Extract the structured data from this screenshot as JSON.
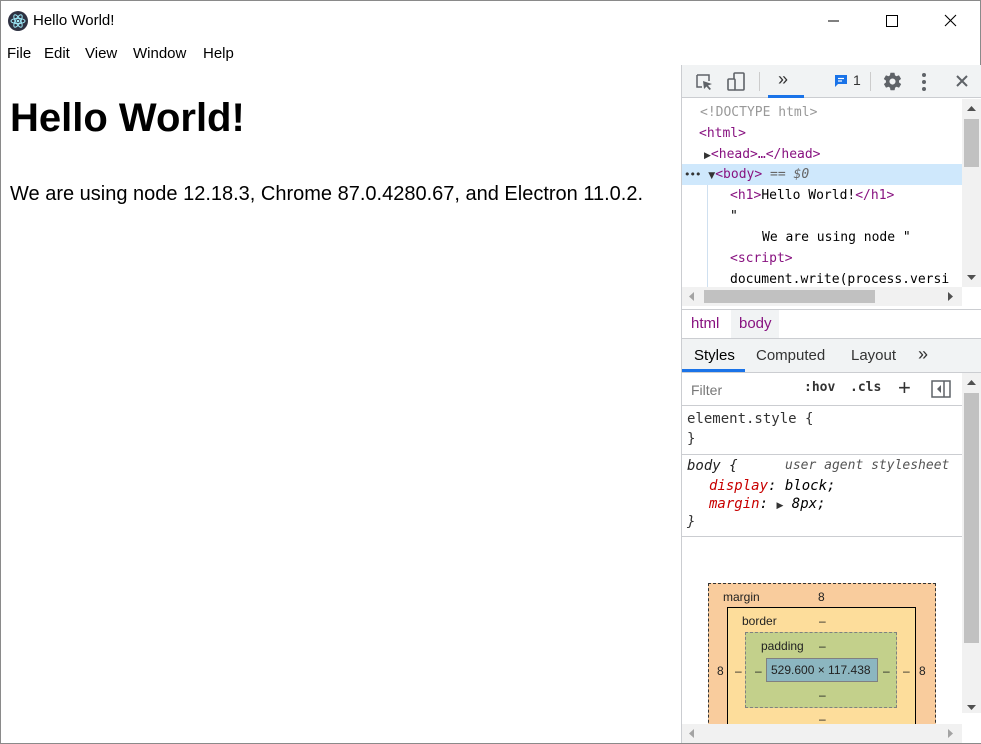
{
  "window": {
    "title": "Hello World!",
    "controls": {
      "minimize": "minimize",
      "maximize": "maximize",
      "close": "close"
    }
  },
  "menu": [
    "File",
    "Edit",
    "View",
    "Window",
    "Help"
  ],
  "page": {
    "heading": "Hello World!",
    "paragraph": "We are using node 12.18.3, Chrome 87.0.4280.67, and Electron 11.0.2."
  },
  "devtools": {
    "toolbar": {
      "more_tabs": "»",
      "issues_count": "1"
    },
    "elements": {
      "doctype": "<!DOCTYPE html>",
      "html_open": "<html>",
      "head_collapsed": "<head>…</head>",
      "body_open": "<body>",
      "body_marker": "== $0",
      "h1_open": "<h1>",
      "h1_text": "Hello World!",
      "h1_close": "</h1>",
      "quote": "\"",
      "text_node": "We are using node \"",
      "script_open": "<script>",
      "script_text": "document.write(process.versi"
    },
    "breadcrumbs": [
      "html",
      "body"
    ],
    "styles_tabs": [
      "Styles",
      "Computed",
      "Layout"
    ],
    "styles_more": "»",
    "filter": {
      "placeholder": "Filter",
      "hov": ":hov",
      "cls": ".cls",
      "add": "+"
    },
    "element_style": {
      "selector": "element.style {",
      "close": "}"
    },
    "body_rule": {
      "selector": "body",
      "brace_open": "{",
      "source": "user agent stylesheet",
      "props": [
        {
          "name": "display",
          "value": "block;"
        },
        {
          "name": "margin",
          "value": "8px;"
        }
      ],
      "brace_close": "}"
    },
    "box_model": {
      "margin_label": "margin",
      "margin_top": "8",
      "margin_left": "8",
      "margin_right": "8",
      "border_label": "border",
      "border_top": "–",
      "border_left": "–",
      "border_right": "–",
      "border_bottom": "–",
      "padding_label": "padding",
      "padding_top": "–",
      "padding_left": "–",
      "padding_right": "–",
      "padding_bottom": "–",
      "content": "529.600 × 117.438"
    }
  },
  "colors": {
    "accent": "#1a73e8",
    "tag": "#881280",
    "selection": "#cfe8fc"
  }
}
